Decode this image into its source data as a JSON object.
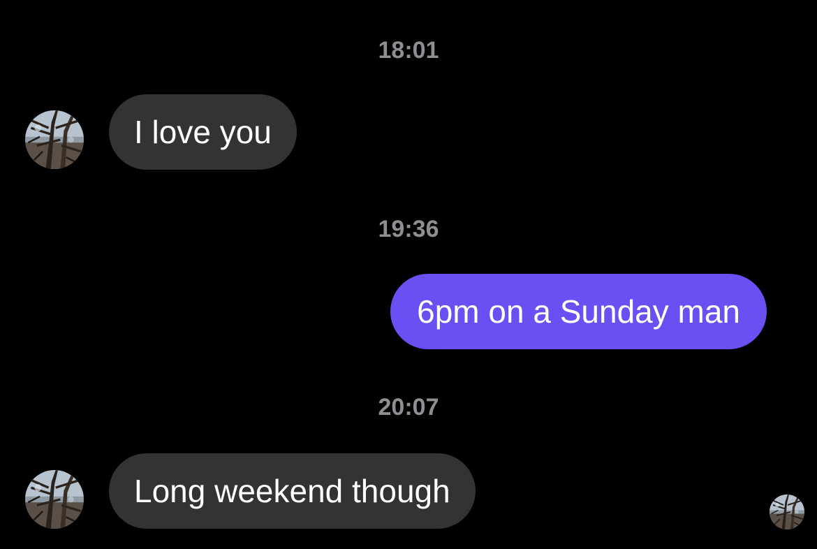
{
  "conversation": {
    "messages": [
      {
        "timestamp": "18:01",
        "direction": "incoming",
        "text": "I love you"
      },
      {
        "timestamp": "19:36",
        "direction": "outgoing",
        "text": "6pm on a Sunday man"
      },
      {
        "timestamp": "20:07",
        "direction": "incoming",
        "text": "Long weekend though"
      }
    ],
    "read_receipt": {
      "icon": "contact-avatar-icon"
    }
  },
  "colors": {
    "background": "#000000",
    "incoming_bubble": "#333333",
    "outgoing_bubble": "#6a50f2",
    "timestamp_text": "#8e8e93",
    "message_text": "#ffffff"
  }
}
